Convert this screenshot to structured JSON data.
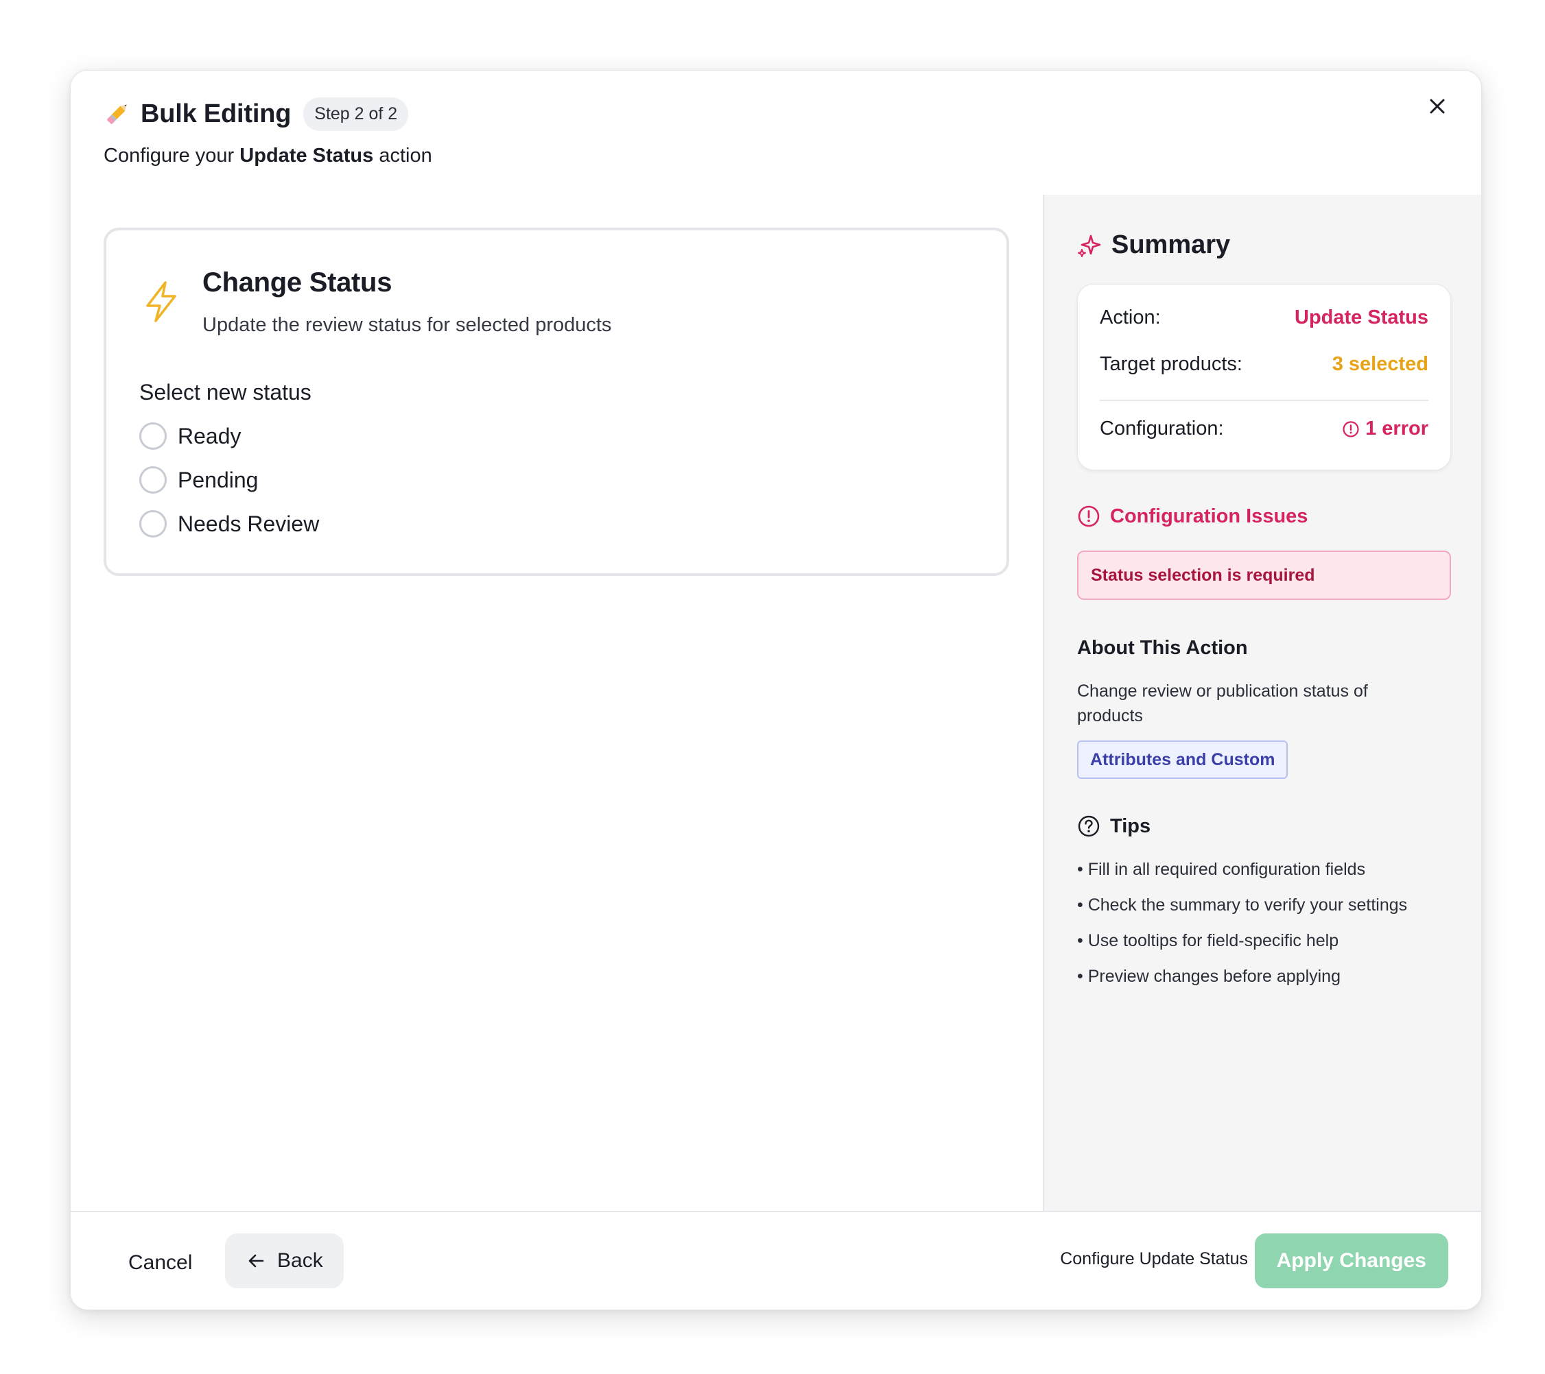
{
  "header": {
    "title": "Bulk Editing",
    "step_badge": "Step 2 of 2",
    "subtitle_prefix": "Configure your",
    "subtitle_action": "Update Status",
    "subtitle_suffix": "action",
    "close_icon": "close-icon"
  },
  "card": {
    "title": "Change Status",
    "description": "Update the review status for selected products",
    "field_label": "Select new status",
    "options": [
      {
        "label": "Ready",
        "selected": false
      },
      {
        "label": "Pending",
        "selected": false
      },
      {
        "label": "Needs Review",
        "selected": false
      }
    ],
    "icon": "lightning-icon",
    "icon_color": "#f0b429"
  },
  "summary": {
    "title": "Summary",
    "rows": {
      "action_label": "Action:",
      "action_value": "Update Status",
      "target_label": "Target products:",
      "target_value": "3 selected",
      "config_label": "Configuration:",
      "config_value": "1 error"
    },
    "colors": {
      "pink": "#d6245f",
      "orange": "#e8a317"
    }
  },
  "issues": {
    "title": "Configuration Issues",
    "items": [
      "Status selection is required"
    ]
  },
  "about": {
    "title": "About This Action",
    "description": "Change review or publication status of products",
    "tag": "Attributes and Custom"
  },
  "tips": {
    "title": "Tips",
    "items": [
      "Fill in all required configuration fields",
      "Check the summary to verify your settings",
      "Use tooltips for field-specific help",
      "Preview changes before applying"
    ]
  },
  "footer": {
    "cancel_label": "Cancel",
    "back_label": "Back",
    "hint": "Configure Update Status",
    "apply_label": "Apply Changes",
    "apply_color": "#8fd5b0"
  }
}
